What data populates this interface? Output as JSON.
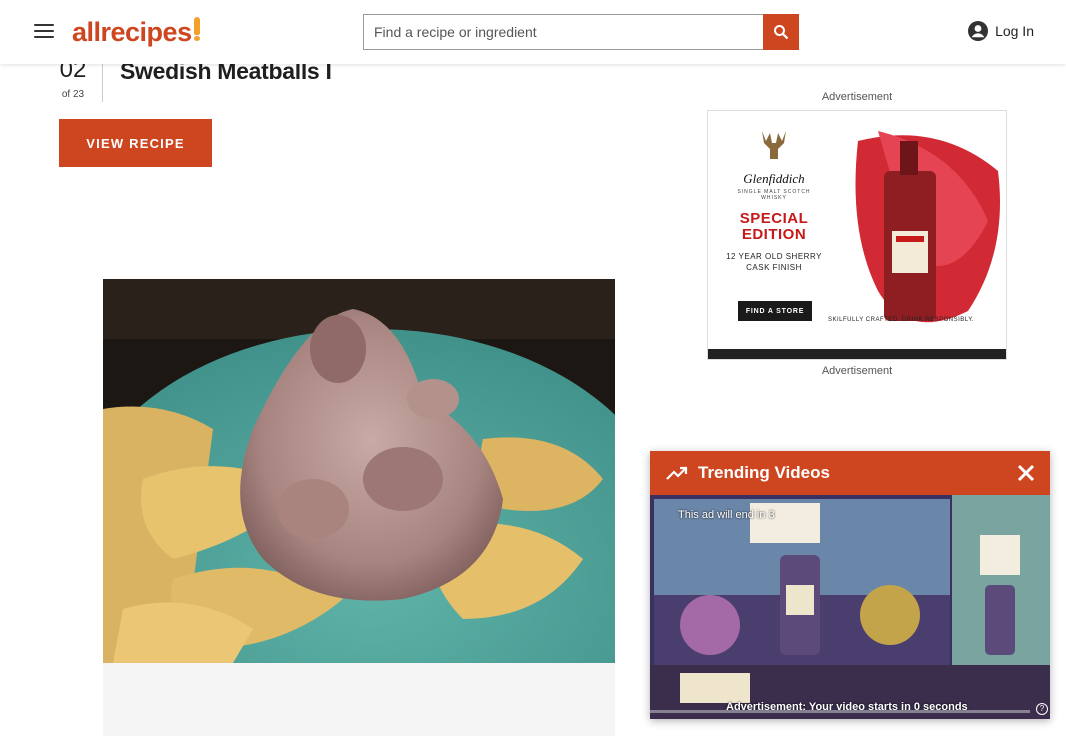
{
  "header": {
    "logo_text": "allrecipes",
    "search_placeholder": "Find a recipe or ingredient",
    "login_label": "Log In"
  },
  "slide": {
    "number": "02",
    "of_label": "of 23",
    "title": "Swedish Meatballs I",
    "button_label": "VIEW RECIPE"
  },
  "sidebar": {
    "ad_label_top": "Advertisement",
    "ad_label_bottom": "Advertisement",
    "ad": {
      "brand": "Glenfiddich",
      "brand_sub": "SINGLE MALT SCOTCH WHISKY",
      "special": "SPECIAL EDITION",
      "sherry": "12 YEAR OLD SHERRY CASK FINISH",
      "store_button": "FIND A STORE",
      "tagline": "SKILFULLY CRAFTED. DRINK RESPONSIBLY."
    }
  },
  "trending": {
    "title": "Trending Videos",
    "overlay_text": "This ad will end in 3",
    "ad_caption": "Advertisement: Your video starts in 0 seconds",
    "help_glyph": "?"
  },
  "colors": {
    "brand": "#ce4620",
    "spoon": "#f2a12d"
  }
}
